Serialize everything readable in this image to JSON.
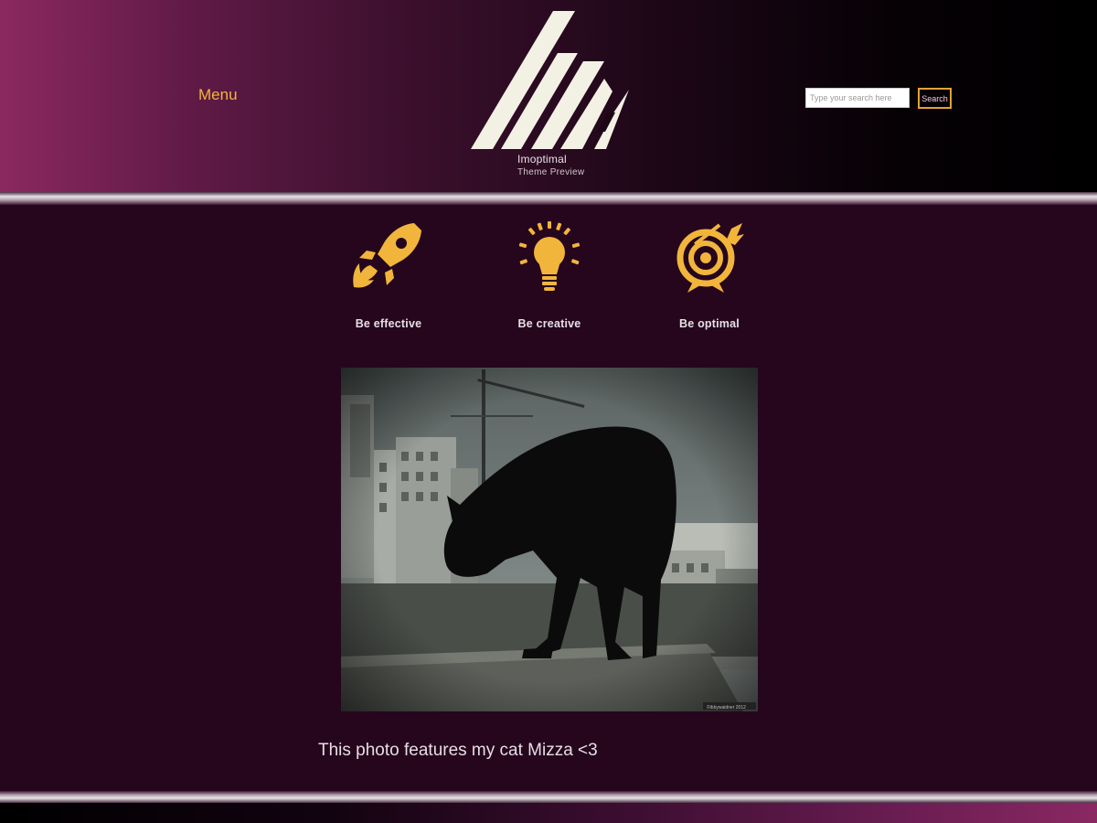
{
  "header": {
    "menu_label": "Menu",
    "site_name": "Imoptimal",
    "site_tagline": "Theme Preview",
    "logo_icon": "imoptimal-logo",
    "search": {
      "placeholder": "Type your search here",
      "value": "",
      "button_label": "Search"
    }
  },
  "features": [
    {
      "icon": "rocket-icon",
      "label": "Be effective"
    },
    {
      "icon": "lightbulb-icon",
      "label": "Be creative"
    },
    {
      "icon": "target-icon",
      "label": "Be optimal"
    }
  ],
  "photo": {
    "caption": "This photo features my cat Mizza <3"
  },
  "colors": {
    "accent": "#f2b53b",
    "background": "#25061d",
    "header_start": "#8b2861",
    "header_end": "#000000"
  }
}
